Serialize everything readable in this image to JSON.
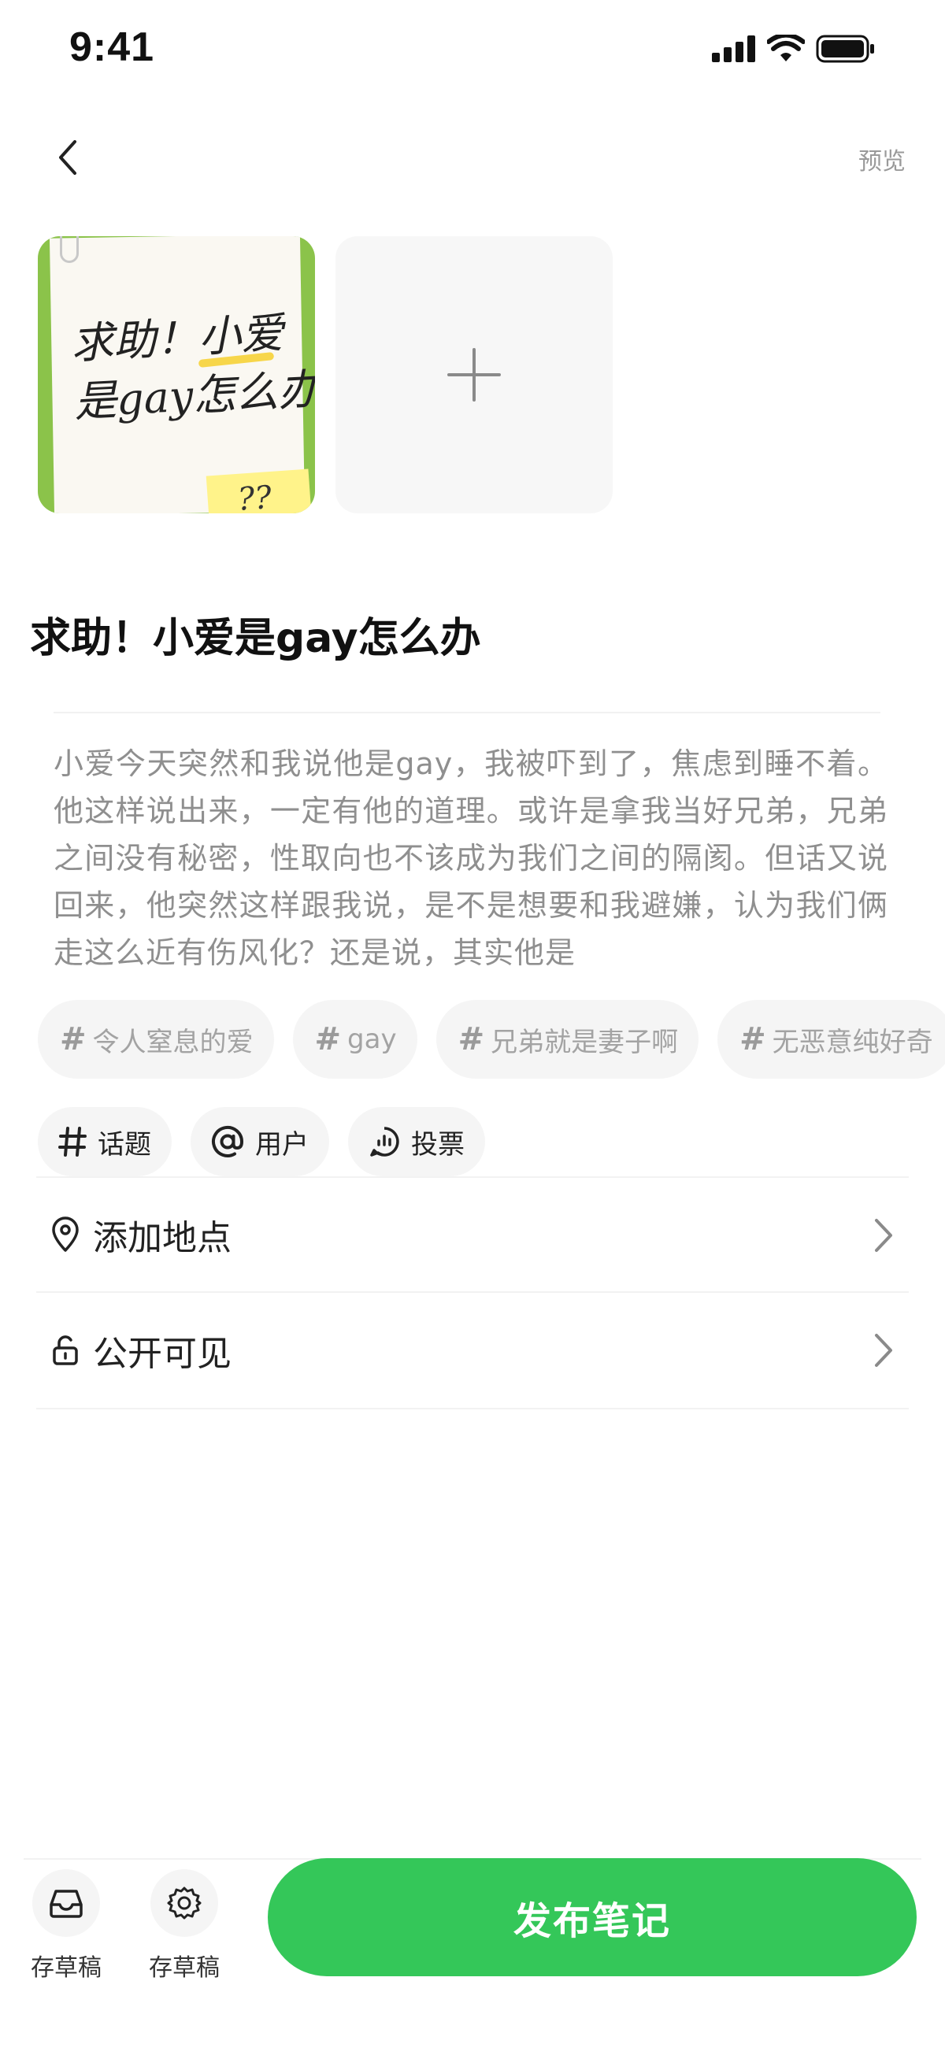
{
  "status_bar": {
    "time": "9:41",
    "icons": [
      "signal-icon",
      "wifi-icon",
      "battery-icon"
    ]
  },
  "nav": {
    "back_icon": "chevron-left-icon",
    "preview_label": "预览"
  },
  "images": {
    "thumbnail_text": "求助！小爱\n是gay怎么办",
    "sticky_text": "??",
    "add_icon": "plus-icon"
  },
  "note": {
    "title": "求助！小爱是gay怎么办",
    "body": "小爱今天突然和我说他是gay，我被吓到了，焦虑到睡不着。他这样说出来，一定有他的道理。或许是拿我当好兄弟，兄弟之间没有秘密，性取向也不该成为我们之间的隔阂。但话又说回来，他突然这样跟我说，是不是想要和我避嫌，认为我们俩走这么近有伤风化？还是说，其实他是"
  },
  "tags": [
    {
      "label": "令人窒息的爱"
    },
    {
      "label": "gay"
    },
    {
      "label": "兄弟就是妻子啊"
    },
    {
      "label": "无恶意纯好奇"
    }
  ],
  "actions": [
    {
      "label": "话题",
      "icon": "hashtag-icon"
    },
    {
      "label": "用户",
      "icon": "at-icon"
    },
    {
      "label": "投票",
      "icon": "poll-icon"
    }
  ],
  "settings": {
    "location_label": "添加地点",
    "visibility_label": "公开可见"
  },
  "bottom": {
    "draft1_label": "存草稿",
    "draft2_label": "存草稿",
    "publish_label": "发布笔记"
  },
  "colors": {
    "accent": "#34c759",
    "chip_bg": "#f5f5f5",
    "muted_text": "#8f8f8f"
  }
}
